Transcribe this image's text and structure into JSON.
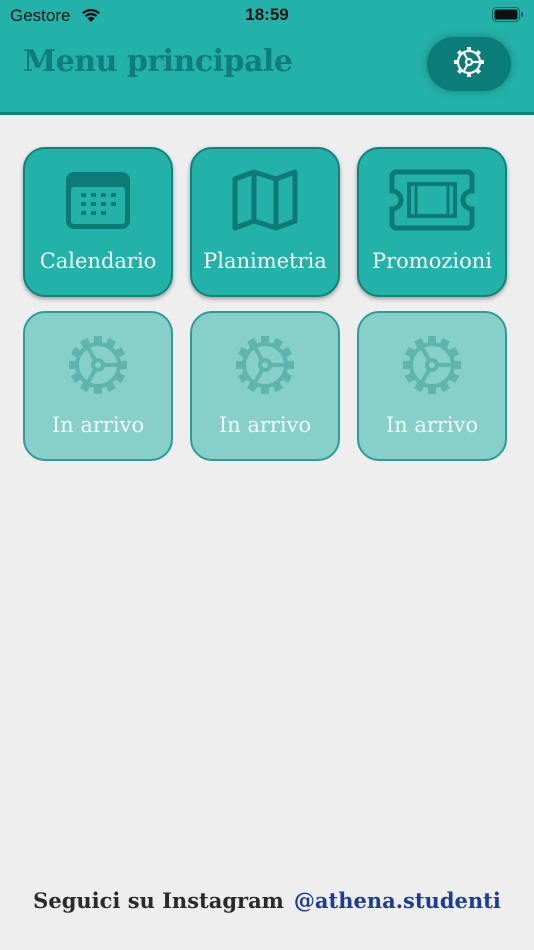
{
  "status_bar": {
    "carrier": "Gestore",
    "time": "18:59"
  },
  "header": {
    "title": "Menu principale",
    "settings_icon": "gear-icon"
  },
  "tiles": [
    {
      "label": "Calendario",
      "icon": "calendar-icon",
      "enabled": true
    },
    {
      "label": "Planimetria",
      "icon": "map-icon",
      "enabled": true
    },
    {
      "label": "Promozioni",
      "icon": "ticket-icon",
      "enabled": true
    },
    {
      "label": "In arrivo",
      "icon": "gear-icon",
      "enabled": false
    },
    {
      "label": "In arrivo",
      "icon": "gear-icon",
      "enabled": false
    },
    {
      "label": "In arrivo",
      "icon": "gear-icon",
      "enabled": false
    }
  ],
  "footer": {
    "label": "Seguici su Instagram",
    "link": "@athena.studenti"
  },
  "colors": {
    "primary": "#22b2aa",
    "primary_dark": "#0f7d78",
    "tile_disabled": "#86d0c9",
    "link": "#1b3d96",
    "background": "#eeeeee"
  }
}
